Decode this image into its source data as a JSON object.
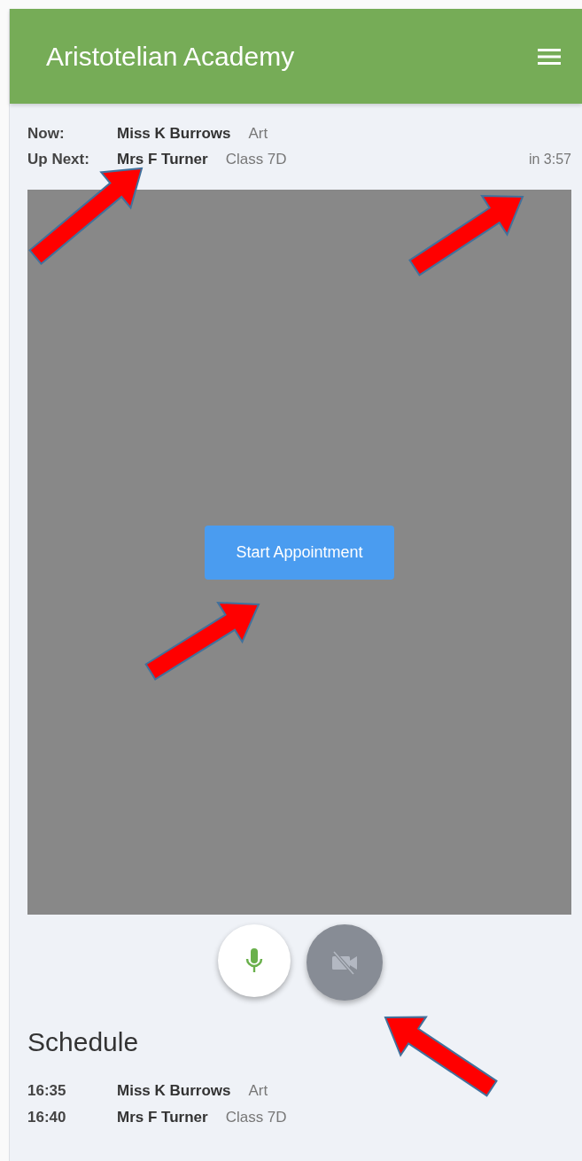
{
  "header": {
    "title": "Aristotelian Academy"
  },
  "status": [
    {
      "label": "Now:",
      "name": "Miss K Burrows",
      "detail": "Art"
    },
    {
      "label": "Up Next:",
      "name": "Mrs F Turner",
      "detail": "Class 7D",
      "countdown": "in 3:57"
    }
  ],
  "video": {
    "button": "Start Appointment"
  },
  "controls": [
    {
      "kind": "microphone",
      "on": true
    },
    {
      "kind": "camera",
      "on": false
    }
  ],
  "schedule": {
    "title": "Schedule",
    "rows": [
      {
        "time": "16:35",
        "name": "Miss K Burrows",
        "detail": "Art"
      },
      {
        "time": "16:40",
        "name": "Mrs F Turner",
        "detail": "Class 7D"
      }
    ]
  },
  "annotations": [
    {
      "kind": "arrow"
    },
    {
      "kind": "arrow"
    },
    {
      "kind": "arrow"
    },
    {
      "kind": "arrow"
    }
  ]
}
